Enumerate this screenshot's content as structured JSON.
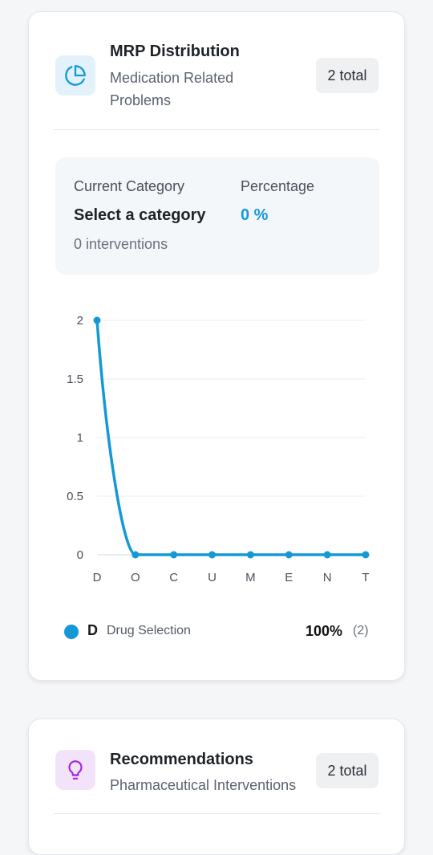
{
  "mrp_card": {
    "icon": "pie-chart-icon",
    "title": "MRP Distribution",
    "subtitle": "Medication Related Problems",
    "badge": "2 total",
    "current_category_label": "Current Category",
    "current_category_value": "Select a category",
    "interventions": "0 interventions",
    "percentage_label": "Percentage",
    "percentage_value": "0 %",
    "legend": {
      "code": "D",
      "name": "Drug Selection",
      "percent": "100%",
      "count": "(2)"
    }
  },
  "recommendations_card": {
    "icon": "lightbulb-icon",
    "title": "Recommendations",
    "subtitle": "Pharmaceutical Interventions",
    "badge": "2 total"
  },
  "colors": {
    "accent": "#1499d6",
    "mrp_icon_bg": "#e3f1fb",
    "rec_icon": "#a329d9",
    "rec_icon_bg": "#f2e3fb",
    "grid": "#eceef1"
  },
  "chart_data": {
    "type": "line",
    "categories": [
      "D",
      "O",
      "C",
      "U",
      "M",
      "E",
      "N",
      "T"
    ],
    "series": [
      {
        "values": [
          2,
          0,
          0,
          0,
          0,
          0,
          0,
          0
        ]
      }
    ],
    "ylim": [
      0,
      2
    ],
    "yticks": [
      "0",
      "0.5",
      "1",
      "1.5",
      "2"
    ],
    "grid": true
  }
}
